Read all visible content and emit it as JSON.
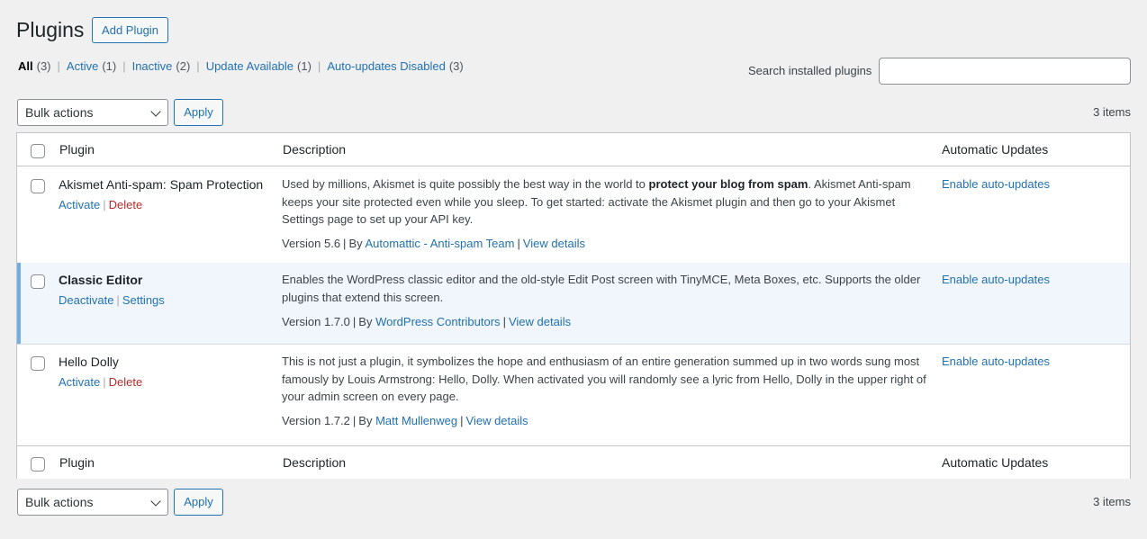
{
  "page": {
    "title": "Plugins",
    "add_button": "Add Plugin"
  },
  "filters": [
    {
      "label": "All",
      "count": "(3)",
      "current": true
    },
    {
      "label": "Active",
      "count": "(1)"
    },
    {
      "label": "Inactive",
      "count": "(2)"
    },
    {
      "label": "Update Available",
      "count": "(1)"
    },
    {
      "label": "Auto-updates Disabled",
      "count": "(3)"
    }
  ],
  "search": {
    "label": "Search installed plugins",
    "value": ""
  },
  "bulk": {
    "select_value": "Bulk actions",
    "apply_label": "Apply",
    "items_count": "3 items"
  },
  "columns": {
    "plugin": "Plugin",
    "description": "Description",
    "auto_updates": "Automatic Updates"
  },
  "plugins": [
    {
      "name": "Akismet Anti-spam: Spam Protection",
      "actions": [
        "Activate",
        "Delete"
      ],
      "desc_pre": "Used by millions, Akismet is quite possibly the best way in the world to ",
      "desc_bold": "protect your blog from spam",
      "desc_post": ". Akismet Anti-spam keeps your site protected even while you sleep. To get started: activate the Akismet plugin and then go to your Akismet Settings page to set up your API key.",
      "version": "Version 5.6",
      "by": "By",
      "author": "Automattic - Anti-spam Team",
      "details": "View details",
      "auto_update": "Enable auto-updates"
    },
    {
      "name": "Classic Editor",
      "actions": [
        "Deactivate",
        "Settings"
      ],
      "desc_pre": "Enables the WordPress classic editor and the old-style Edit Post screen with TinyMCE, Meta Boxes, etc. Supports the older plugins that extend this screen.",
      "version": "Version 1.7.0",
      "by": "By",
      "author": "WordPress Contributors",
      "details": "View details",
      "auto_update": "Enable auto-updates"
    },
    {
      "name": "Hello Dolly",
      "actions": [
        "Activate",
        "Delete"
      ],
      "desc_pre": "This is not just a plugin, it symbolizes the hope and enthusiasm of an entire generation summed up in two words sung most famously by Louis Armstrong: Hello, Dolly. When activated you will randomly see a lyric from Hello, Dolly in the upper right of your admin screen on every page.",
      "version": "Version 1.7.2",
      "by": "By",
      "author": "Matt Mullenweg",
      "details": "View details",
      "auto_update": "Enable auto-updates"
    }
  ],
  "colors": {
    "link": "#2271b1",
    "delete": "#b32d2e",
    "active_row": "#f0f6fc",
    "active_bar": "#72aee6"
  }
}
